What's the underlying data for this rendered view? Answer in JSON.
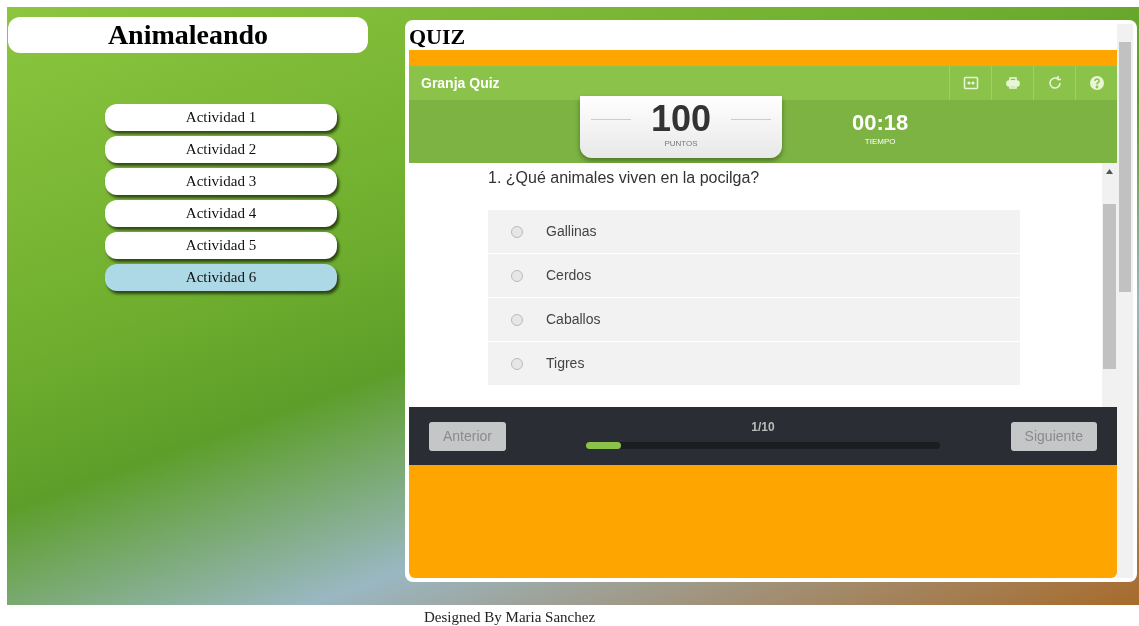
{
  "site_title": "Animaleando",
  "nav": [
    {
      "label": "Actividad 1",
      "selected": false
    },
    {
      "label": "Actividad 2",
      "selected": false
    },
    {
      "label": "Actividad 3",
      "selected": false
    },
    {
      "label": "Actividad 4",
      "selected": false
    },
    {
      "label": "Actividad 5",
      "selected": false
    },
    {
      "label": "Actividad 6",
      "selected": true
    }
  ],
  "section_title": "QUIZ",
  "quiz": {
    "title": "Granja Quiz",
    "score": "100",
    "score_label": "PUNTOS",
    "time": "00:18",
    "time_label": "TIEMPO",
    "question": "1. ¿Qué animales viven en la pocilga?",
    "options": [
      {
        "label": "Gallinas",
        "selected": false
      },
      {
        "label": "Cerdos",
        "selected": false
      },
      {
        "label": "Caballos",
        "selected": false
      },
      {
        "label": "Tigres",
        "selected": false
      }
    ],
    "prev_button": {
      "label": "Anterior",
      "disabled": true
    },
    "progress": {
      "label": "1/10",
      "level": 0.1
    },
    "next_button": {
      "label": "Siguiente",
      "disabled": true
    }
  },
  "footer": "Designed By Maria Sanchez"
}
